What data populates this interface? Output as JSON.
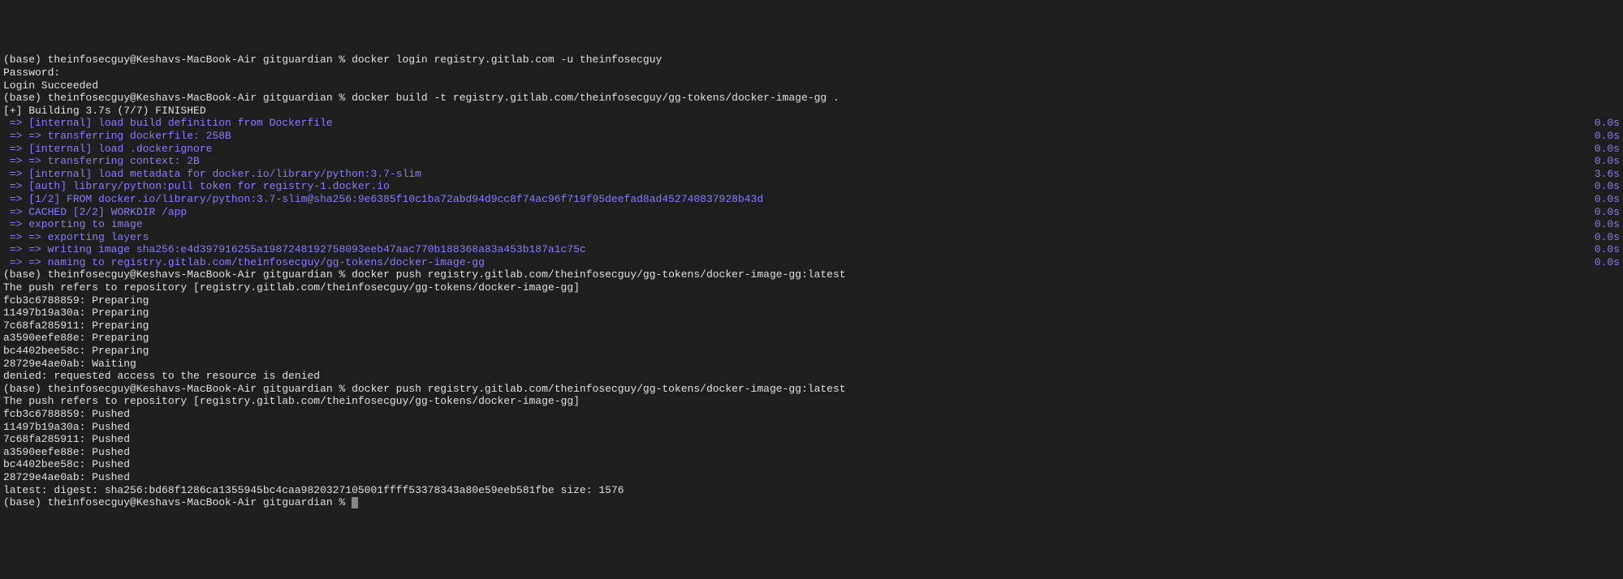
{
  "prompt_prefix": "(base) theinfosecguy@Keshavs-MacBook-Air gitguardian % ",
  "cmd1": "docker login registry.gitlab.com -u theinfosecguy",
  "password_label": "Password:",
  "login_success": "Login Succeeded",
  "cmd2": "docker build -t registry.gitlab.com/theinfosecguy/gg-tokens/docker-image-gg .",
  "build_header": "[+] Building 3.7s (7/7) FINISHED",
  "steps": [
    {
      "text": " => [internal] load build definition from Dockerfile",
      "time": "0.0s"
    },
    {
      "text": " => => transferring dockerfile: 258B",
      "time": "0.0s"
    },
    {
      "text": " => [internal] load .dockerignore",
      "time": "0.0s"
    },
    {
      "text": " => => transferring context: 2B",
      "time": "0.0s"
    },
    {
      "text": " => [internal] load metadata for docker.io/library/python:3.7-slim",
      "time": "3.6s"
    },
    {
      "text": " => [auth] library/python:pull token for registry-1.docker.io",
      "time": "0.0s"
    },
    {
      "text": " => [1/2] FROM docker.io/library/python:3.7-slim@sha256:9e6385f10c1ba72abd94d9cc8f74ac96f719f95deefad8ad452740837928b43d",
      "time": "0.0s"
    },
    {
      "text": " => CACHED [2/2] WORKDIR /app",
      "time": "0.0s"
    },
    {
      "text": " => exporting to image",
      "time": "0.0s"
    },
    {
      "text": " => => exporting layers",
      "time": "0.0s"
    },
    {
      "text": " => => writing image sha256:e4d397916255a1987248192758093eeb47aac770b188368a83a453b187a1c75c",
      "time": "0.0s"
    },
    {
      "text": " => => naming to registry.gitlab.com/theinfosecguy/gg-tokens/docker-image-gg",
      "time": "0.0s"
    }
  ],
  "cmd3": "docker push registry.gitlab.com/theinfosecguy/gg-tokens/docker-image-gg:latest",
  "push_refers": "The push refers to repository [registry.gitlab.com/theinfosecguy/gg-tokens/docker-image-gg]",
  "push1_layers": [
    "fcb3c6788859: Preparing",
    "11497b19a30a: Preparing",
    "7c68fa285911: Preparing",
    "a3590eefe88e: Preparing",
    "bc4402bee58c: Preparing",
    "28729e4ae0ab: Waiting"
  ],
  "denied": "denied: requested access to the resource is denied",
  "cmd4": "docker push registry.gitlab.com/theinfosecguy/gg-tokens/docker-image-gg:latest",
  "push2_layers": [
    "fcb3c6788859: Pushed",
    "11497b19a30a: Pushed",
    "7c68fa285911: Pushed",
    "a3590eefe88e: Pushed",
    "bc4402bee58c: Pushed",
    "28729e4ae0ab: Pushed"
  ],
  "digest_line": "latest: digest: sha256:bd68f1286ca1355945bc4caa9820327105001ffff53378343a80e59eeb581fbe size: 1576"
}
